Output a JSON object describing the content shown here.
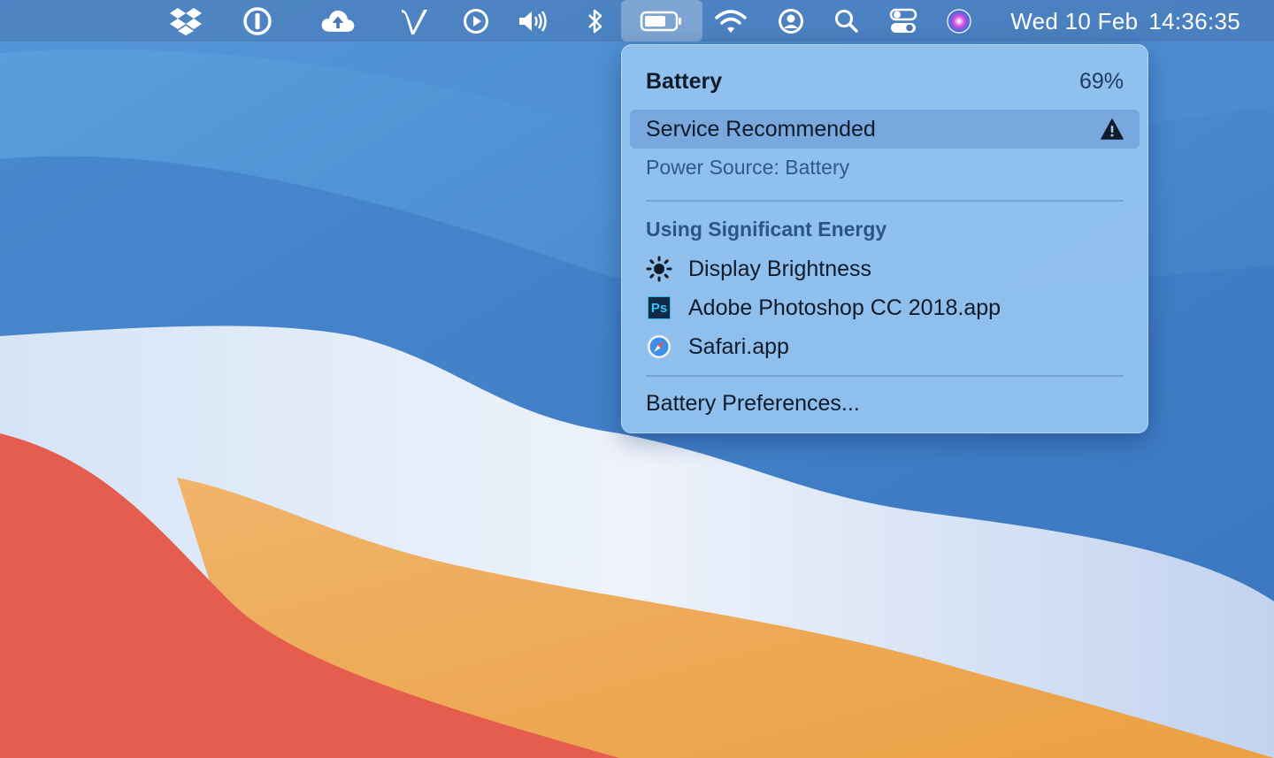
{
  "menubar": {
    "icons": [
      "dropbox-icon",
      "1password-icon",
      "cloud-upload-icon",
      "vectorworks-icon",
      "play-icon",
      "volume-icon",
      "bluetooth-icon",
      "battery-icon",
      "wifi-icon",
      "user-icon",
      "search-icon",
      "control-center-icon",
      "siri-icon"
    ],
    "clock": {
      "day": "Wed 10 Feb",
      "time": "14:36:35"
    }
  },
  "battery_menu": {
    "title": "Battery",
    "percent": "69%",
    "service": "Service Recommended",
    "power_source": "Power Source: Battery",
    "energy_header": "Using Significant Energy",
    "apps": [
      {
        "label": "Display Brightness",
        "icon": "brightness-icon"
      },
      {
        "label": "Adobe Photoshop CC 2018.app",
        "icon": "photoshop-icon",
        "icon_text": "Ps"
      },
      {
        "label": "Safari.app",
        "icon": "safari-icon"
      }
    ],
    "preferences": "Battery Preferences..."
  },
  "colors": {
    "menu_bg": "#96c4f0",
    "wallpaper_blue": "#3f7fc6",
    "wallpaper_red": "#e55b4e",
    "wallpaper_orange": "#efa44e"
  }
}
